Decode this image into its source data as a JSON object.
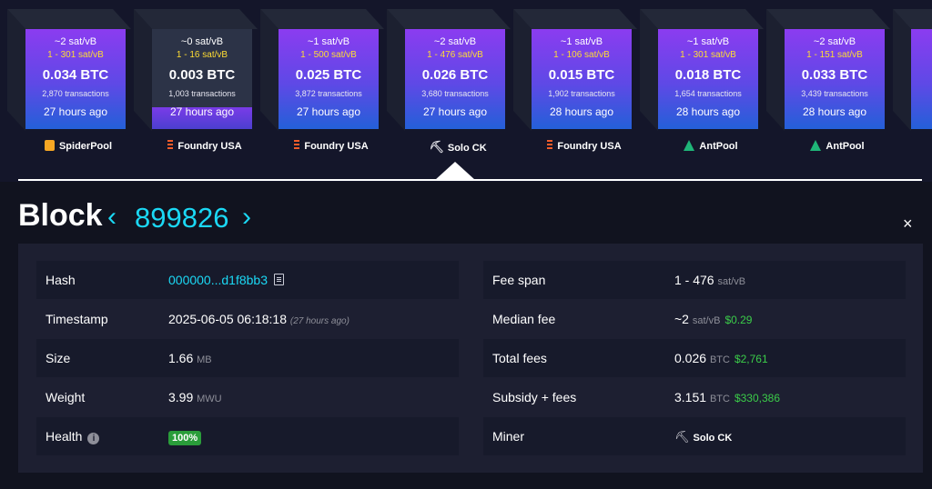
{
  "blocks": [
    {
      "fee": "~2 sat/vB",
      "range": "1 - 301 sat/vB",
      "btc": "0.034 BTC",
      "tx": "2,870 transactions",
      "ago": "27 hours ago",
      "miner": "SpiderPool",
      "miner_icon": "spiderpool-icon"
    },
    {
      "fee": "~0 sat/vB",
      "range": "1 - 16 sat/vB",
      "btc": "0.003 BTC",
      "tx": "1,003 transactions",
      "ago": "27 hours ago",
      "miner": "Foundry USA",
      "miner_icon": "foundry-icon"
    },
    {
      "fee": "~1 sat/vB",
      "range": "1 - 500 sat/vB",
      "btc": "0.025 BTC",
      "tx": "3,872 transactions",
      "ago": "27 hours ago",
      "miner": "Foundry USA",
      "miner_icon": "foundry-icon"
    },
    {
      "fee": "~2 sat/vB",
      "range": "1 - 476 sat/vB",
      "btc": "0.026 BTC",
      "tx": "3,680 transactions",
      "ago": "27 hours ago",
      "miner": "Solo CK",
      "miner_icon": "pickaxe-icon"
    },
    {
      "fee": "~1 sat/vB",
      "range": "1 - 106 sat/vB",
      "btc": "0.015 BTC",
      "tx": "1,902 transactions",
      "ago": "28 hours ago",
      "miner": "Foundry USA",
      "miner_icon": "foundry-icon"
    },
    {
      "fee": "~1 sat/vB",
      "range": "1 - 301 sat/vB",
      "btc": "0.018 BTC",
      "tx": "1,654 transactions",
      "ago": "28 hours ago",
      "miner": "AntPool",
      "miner_icon": "antpool-icon"
    },
    {
      "fee": "~2 sat/vB",
      "range": "1 - 151 sat/vB",
      "btc": "0.033 BTC",
      "tx": "3,439 transactions",
      "ago": "28 hours ago",
      "miner": "AntPool",
      "miner_icon": "antpool-icon"
    }
  ],
  "header": {
    "title": "Block",
    "prev": "‹",
    "height": "899826",
    "next": "›",
    "close": "×"
  },
  "details": {
    "hash_label": "Hash",
    "hash_value": "000000...d1f8bb3",
    "timestamp_label": "Timestamp",
    "timestamp_value": "2025-06-05 06:18:18",
    "timestamp_rel": "(27 hours ago)",
    "size_label": "Size",
    "size_value": "1.66",
    "size_unit": "MB",
    "weight_label": "Weight",
    "weight_value": "3.99",
    "weight_unit": "MWU",
    "health_label": "Health",
    "health_value": "100%",
    "fee_span_label": "Fee span",
    "fee_span_value": "1 - 476",
    "fee_span_unit": "sat/vB",
    "median_fee_label": "Median fee",
    "median_fee_value": "~2",
    "median_fee_unit": "sat/vB",
    "median_fee_usd": "$0.29",
    "total_fees_label": "Total fees",
    "total_fees_value": "0.026",
    "total_fees_unit": "BTC",
    "total_fees_usd": "$2,761",
    "subsidy_label": "Subsidy + fees",
    "subsidy_value": "3.151",
    "subsidy_unit": "BTC",
    "subsidy_usd": "$330,386",
    "miner_label": "Miner",
    "miner_value": "Solo CK"
  },
  "colors": {
    "accent": "#1bd8f4",
    "usd": "#3bcc49",
    "health": "#2a9d3a",
    "fee_range": "#ffdd33"
  }
}
